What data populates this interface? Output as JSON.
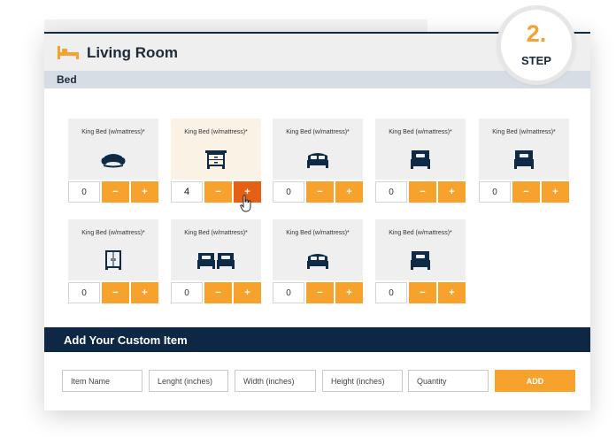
{
  "header": {
    "title": "Living Room",
    "room_icon": "bed-icon"
  },
  "section": {
    "label": "Bed"
  },
  "step": {
    "number": "2.",
    "label": "STEP"
  },
  "items": [
    {
      "name": "King Bed (w/mattress)*",
      "icon": "armchair-icon",
      "qty": "0",
      "minus": "−",
      "plus": "+"
    },
    {
      "name": "King Bed (w/mattress)*",
      "icon": "nightstand-icon",
      "qty": "4",
      "minus": "−",
      "plus": "+"
    },
    {
      "name": "King Bed (w/mattress)*",
      "icon": "double-bed-icon",
      "qty": "0",
      "minus": "−",
      "plus": "+"
    },
    {
      "name": "King Bed (w/mattress)*",
      "icon": "single-bed-icon",
      "qty": "0",
      "minus": "−",
      "plus": "+"
    },
    {
      "name": "King Bed (w/mattress)*",
      "icon": "single-bed-icon",
      "qty": "0",
      "minus": "−",
      "plus": "+"
    },
    {
      "name": "King Bed (w/mattress)*",
      "icon": "wardrobe-icon",
      "qty": "0",
      "minus": "−",
      "plus": "+"
    },
    {
      "name": "King Bed (w/mattress)*",
      "icon": "twin-beds-icon",
      "qty": "0",
      "minus": "−",
      "plus": "+"
    },
    {
      "name": "King Bed (w/mattress)*",
      "icon": "double-bed-icon",
      "qty": "0",
      "minus": "−",
      "plus": "+"
    },
    {
      "name": "King Bed (w/mattress)*",
      "icon": "single-bed-icon",
      "qty": "0",
      "minus": "−",
      "plus": "+"
    }
  ],
  "custom": {
    "title": "Add Your Custom Item",
    "fields": [
      "Item Name",
      "Lenght (inches)",
      "Width (inches)",
      "Height (inches)",
      "Quantity"
    ],
    "add_label": "ADD"
  },
  "colors": {
    "accent": "#f7a22d",
    "accent_active": "#e55f14",
    "navy": "#0d2745"
  }
}
